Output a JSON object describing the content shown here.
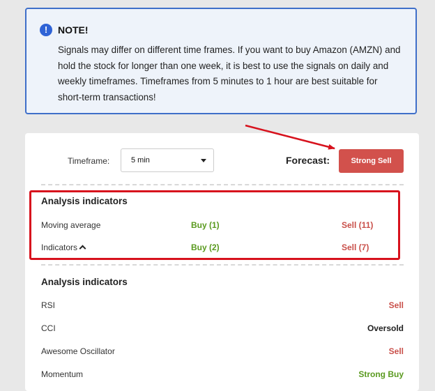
{
  "note": {
    "icon": "info-icon",
    "icon_glyph": "!",
    "title": "NOTE!",
    "lines": [
      "Signals may differ on different time frames. If you want to buy Amazon (AMZN) and",
      "hold the stock for longer than one week, it is best to use the signals on daily and",
      "weekly timeframes. Timeframes from 5 minutes to 1 hour are best suitable for",
      "short-term transactions!"
    ]
  },
  "controls": {
    "timeframe_label": "Timeframe:",
    "timeframe_value": "5 min",
    "forecast_label": "Forecast:",
    "forecast_value": "Strong Sell"
  },
  "summary": {
    "title": "Analysis indicators",
    "rows": [
      {
        "label": "Moving average",
        "buy": "Buy (1)",
        "sell": "Sell (11)"
      },
      {
        "label": "Indicators",
        "buy": "Buy (2)",
        "sell": "Sell (7)"
      }
    ]
  },
  "details": {
    "title": "Analysis indicators",
    "rows": [
      {
        "label": "RSI",
        "value": "Sell",
        "color": "#c9504a"
      },
      {
        "label": "CCI",
        "value": "Oversold",
        "color": "#222222"
      },
      {
        "label": "Awesome Oscillator",
        "value": "Sell",
        "color": "#c9504a"
      },
      {
        "label": "Momentum",
        "value": "Strong Buy",
        "color": "#5a9a1f"
      }
    ]
  },
  "colors": {
    "accent_blue": "#3f6fc9",
    "buy_green": "#5a9a1f",
    "sell_red": "#c9504a",
    "annotation_red": "#d7121d"
  }
}
